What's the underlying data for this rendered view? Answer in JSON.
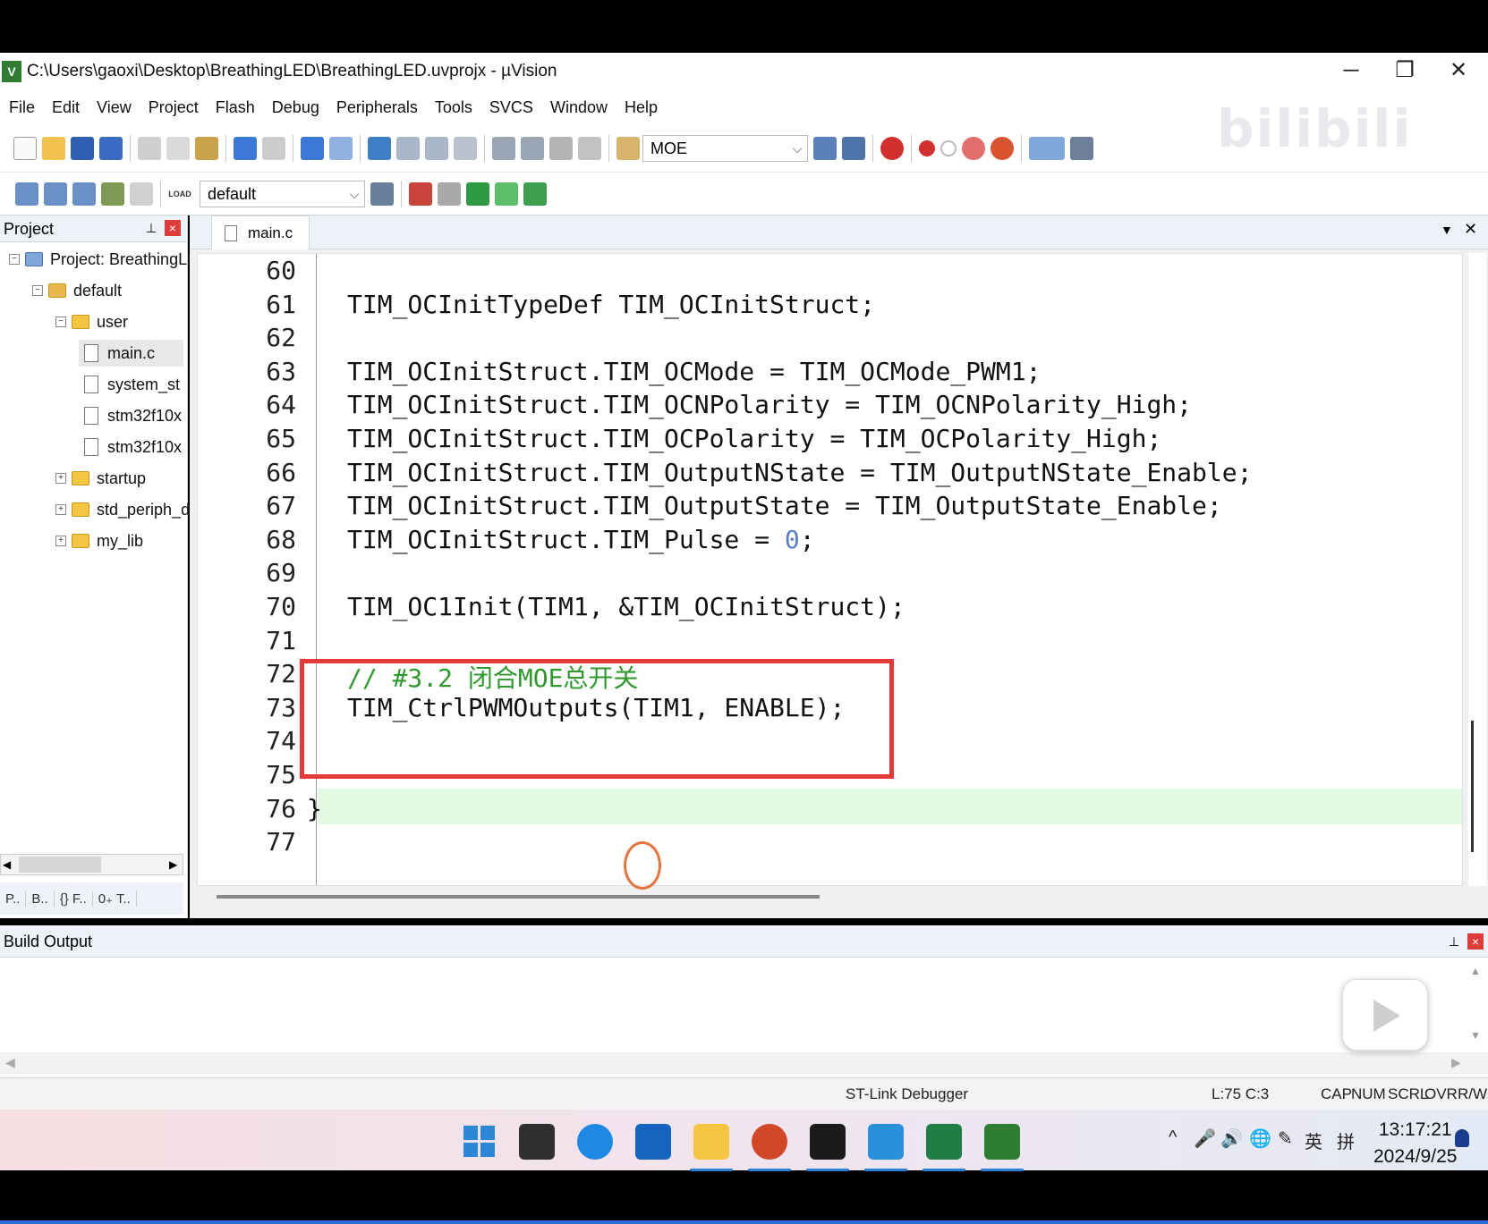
{
  "window": {
    "title": "C:\\Users\\gaoxi\\Desktop\\BreathingLED\\BreathingLED.uvprojx - µVision",
    "app_icon": "V",
    "buttons": [
      "─",
      "❐",
      "✕"
    ]
  },
  "menu": [
    "File",
    "Edit",
    "View",
    "Project",
    "Flash",
    "Debug",
    "Peripherals",
    "Tools",
    "SVCS",
    "Window",
    "Help"
  ],
  "toolbar": {
    "find_value": "MOE",
    "target_value": "default",
    "load_label": "LOAD"
  },
  "project_panel": {
    "title": "Project",
    "tree": [
      {
        "label": "Project: BreathingLED",
        "indent": 0,
        "expander": "⊟",
        "icon": "project-icon"
      },
      {
        "label": "default",
        "indent": 1,
        "expander": "⊟",
        "icon": "target-folder-icon"
      },
      {
        "label": "user",
        "indent": 2,
        "expander": "⊟",
        "icon": "folder-icon"
      },
      {
        "label": "main.c",
        "indent": 3,
        "expander": "",
        "icon": "file-icon",
        "selected": true
      },
      {
        "label": "system_st",
        "indent": 3,
        "expander": "",
        "icon": "file-icon"
      },
      {
        "label": "stm32f10x",
        "indent": 3,
        "expander": "",
        "icon": "file-icon"
      },
      {
        "label": "stm32f10x",
        "indent": 3,
        "expander": "",
        "icon": "file-icon"
      },
      {
        "label": "startup",
        "indent": 2,
        "expander": "⊞",
        "icon": "folder-icon"
      },
      {
        "label": "std_periph_dr",
        "indent": 2,
        "expander": "⊞",
        "icon": "folder-icon"
      },
      {
        "label": "my_lib",
        "indent": 2,
        "expander": "⊞",
        "icon": "folder-icon"
      }
    ],
    "bottom_tabs": [
      "P..",
      "B..",
      "{} F..",
      "0₊ T.."
    ]
  },
  "editor": {
    "tab_label": "main.c",
    "lines": [
      {
        "n": "60",
        "text": ""
      },
      {
        "n": "61",
        "text": "TIM_OCInitTypeDef TIM_OCInitStruct;"
      },
      {
        "n": "62",
        "text": ""
      },
      {
        "n": "63",
        "text": "TIM_OCInitStruct.TIM_OCMode = TIM_OCMode_PWM1;"
      },
      {
        "n": "64",
        "text": "TIM_OCInitStruct.TIM_OCNPolarity = TIM_OCNPolarity_High;"
      },
      {
        "n": "65",
        "text": "TIM_OCInitStruct.TIM_OCPolarity = TIM_OCPolarity_High;"
      },
      {
        "n": "66",
        "text": "TIM_OCInitStruct.TIM_OutputNState = TIM_OutputNState_Enable;"
      },
      {
        "n": "67",
        "text": "TIM_OCInitStruct.TIM_OutputState = TIM_OutputState_Enable;"
      },
      {
        "n": "68",
        "text": "TIM_OCInitStruct.TIM_Pulse = ",
        "num": "0",
        "after": ";"
      },
      {
        "n": "69",
        "text": ""
      },
      {
        "n": "70",
        "text": "TIM_OC1Init(TIM1, &TIM_OCInitStruct);"
      },
      {
        "n": "71",
        "text": ""
      },
      {
        "n": "72",
        "text": "// #3.2 闭合MOE总开关",
        "comment": true
      },
      {
        "n": "73",
        "text": "TIM_CtrlPWMOutputs(TIM1, ENABLE);"
      },
      {
        "n": "74",
        "text": ""
      },
      {
        "n": "75",
        "text": ""
      },
      {
        "n": "76",
        "text": "}"
      },
      {
        "n": "77",
        "text": ""
      }
    ]
  },
  "build_output": {
    "title": "Build Output"
  },
  "status_bar": {
    "debugger": "ST-Link Debugger",
    "position": "L:75 C:3",
    "indicators": [
      "CAP",
      "NUM",
      "SCRL",
      "OVR",
      "R/W"
    ]
  },
  "taskbar": {
    "apps": [
      "start",
      "app-generic",
      "edge",
      "whiteboard",
      "file-explorer",
      "powerpoint",
      "camera",
      "app-blue",
      "excel",
      "keil-uvision"
    ],
    "tray": [
      "^",
      "🎤",
      "🔊",
      "🌐",
      "✎",
      "英",
      "拼"
    ],
    "time": "13:17:21",
    "date": "2024/9/25"
  },
  "watermark": "bilibili"
}
